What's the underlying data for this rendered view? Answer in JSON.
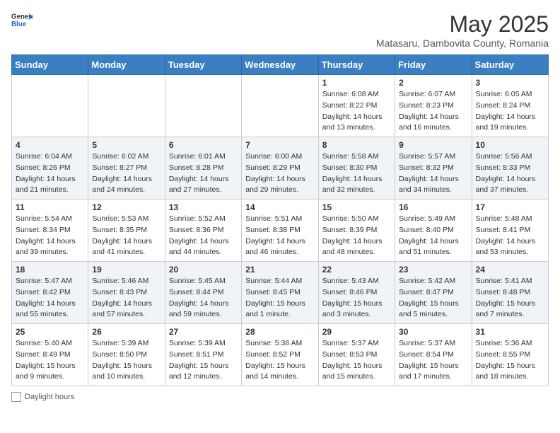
{
  "header": {
    "logo_general": "General",
    "logo_blue": "Blue",
    "month_year": "May 2025",
    "location": "Matasaru, Dambovita County, Romania"
  },
  "weekdays": [
    "Sunday",
    "Monday",
    "Tuesday",
    "Wednesday",
    "Thursday",
    "Friday",
    "Saturday"
  ],
  "rows": [
    [
      {
        "day": "",
        "detail": ""
      },
      {
        "day": "",
        "detail": ""
      },
      {
        "day": "",
        "detail": ""
      },
      {
        "day": "",
        "detail": ""
      },
      {
        "day": "1",
        "detail": "Sunrise: 6:08 AM\nSunset: 8:22 PM\nDaylight: 14 hours and 13 minutes."
      },
      {
        "day": "2",
        "detail": "Sunrise: 6:07 AM\nSunset: 8:23 PM\nDaylight: 14 hours and 16 minutes."
      },
      {
        "day": "3",
        "detail": "Sunrise: 6:05 AM\nSunset: 8:24 PM\nDaylight: 14 hours and 19 minutes."
      }
    ],
    [
      {
        "day": "4",
        "detail": "Sunrise: 6:04 AM\nSunset: 8:26 PM\nDaylight: 14 hours and 21 minutes."
      },
      {
        "day": "5",
        "detail": "Sunrise: 6:02 AM\nSunset: 8:27 PM\nDaylight: 14 hours and 24 minutes."
      },
      {
        "day": "6",
        "detail": "Sunrise: 6:01 AM\nSunset: 8:28 PM\nDaylight: 14 hours and 27 minutes."
      },
      {
        "day": "7",
        "detail": "Sunrise: 6:00 AM\nSunset: 8:29 PM\nDaylight: 14 hours and 29 minutes."
      },
      {
        "day": "8",
        "detail": "Sunrise: 5:58 AM\nSunset: 8:30 PM\nDaylight: 14 hours and 32 minutes."
      },
      {
        "day": "9",
        "detail": "Sunrise: 5:57 AM\nSunset: 8:32 PM\nDaylight: 14 hours and 34 minutes."
      },
      {
        "day": "10",
        "detail": "Sunrise: 5:56 AM\nSunset: 8:33 PM\nDaylight: 14 hours and 37 minutes."
      }
    ],
    [
      {
        "day": "11",
        "detail": "Sunrise: 5:54 AM\nSunset: 8:34 PM\nDaylight: 14 hours and 39 minutes."
      },
      {
        "day": "12",
        "detail": "Sunrise: 5:53 AM\nSunset: 8:35 PM\nDaylight: 14 hours and 41 minutes."
      },
      {
        "day": "13",
        "detail": "Sunrise: 5:52 AM\nSunset: 8:36 PM\nDaylight: 14 hours and 44 minutes."
      },
      {
        "day": "14",
        "detail": "Sunrise: 5:51 AM\nSunset: 8:38 PM\nDaylight: 14 hours and 46 minutes."
      },
      {
        "day": "15",
        "detail": "Sunrise: 5:50 AM\nSunset: 8:39 PM\nDaylight: 14 hours and 48 minutes."
      },
      {
        "day": "16",
        "detail": "Sunrise: 5:49 AM\nSunset: 8:40 PM\nDaylight: 14 hours and 51 minutes."
      },
      {
        "day": "17",
        "detail": "Sunrise: 5:48 AM\nSunset: 8:41 PM\nDaylight: 14 hours and 53 minutes."
      }
    ],
    [
      {
        "day": "18",
        "detail": "Sunrise: 5:47 AM\nSunset: 8:42 PM\nDaylight: 14 hours and 55 minutes."
      },
      {
        "day": "19",
        "detail": "Sunrise: 5:46 AM\nSunset: 8:43 PM\nDaylight: 14 hours and 57 minutes."
      },
      {
        "day": "20",
        "detail": "Sunrise: 5:45 AM\nSunset: 8:44 PM\nDaylight: 14 hours and 59 minutes."
      },
      {
        "day": "21",
        "detail": "Sunrise: 5:44 AM\nSunset: 8:45 PM\nDaylight: 15 hours and 1 minute."
      },
      {
        "day": "22",
        "detail": "Sunrise: 5:43 AM\nSunset: 8:46 PM\nDaylight: 15 hours and 3 minutes."
      },
      {
        "day": "23",
        "detail": "Sunrise: 5:42 AM\nSunset: 8:47 PM\nDaylight: 15 hours and 5 minutes."
      },
      {
        "day": "24",
        "detail": "Sunrise: 5:41 AM\nSunset: 8:48 PM\nDaylight: 15 hours and 7 minutes."
      }
    ],
    [
      {
        "day": "25",
        "detail": "Sunrise: 5:40 AM\nSunset: 8:49 PM\nDaylight: 15 hours and 9 minutes."
      },
      {
        "day": "26",
        "detail": "Sunrise: 5:39 AM\nSunset: 8:50 PM\nDaylight: 15 hours and 10 minutes."
      },
      {
        "day": "27",
        "detail": "Sunrise: 5:39 AM\nSunset: 8:51 PM\nDaylight: 15 hours and 12 minutes."
      },
      {
        "day": "28",
        "detail": "Sunrise: 5:38 AM\nSunset: 8:52 PM\nDaylight: 15 hours and 14 minutes."
      },
      {
        "day": "29",
        "detail": "Sunrise: 5:37 AM\nSunset: 8:53 PM\nDaylight: 15 hours and 15 minutes."
      },
      {
        "day": "30",
        "detail": "Sunrise: 5:37 AM\nSunset: 8:54 PM\nDaylight: 15 hours and 17 minutes."
      },
      {
        "day": "31",
        "detail": "Sunrise: 5:36 AM\nSunset: 8:55 PM\nDaylight: 15 hours and 18 minutes."
      }
    ]
  ],
  "legend": {
    "daylight_label": "Daylight hours"
  }
}
